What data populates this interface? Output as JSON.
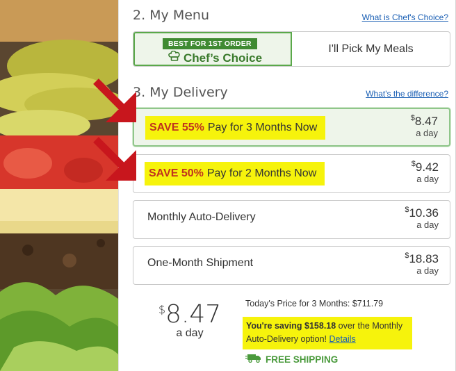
{
  "menu": {
    "section_title": "2. My Menu",
    "help_link": "What is Chef's Choice?",
    "chef_badge": "BEST FOR 1ST ORDER",
    "chef_label": "Chef’s Choice",
    "pick_label": "I'll Pick My Meals"
  },
  "delivery": {
    "section_title": "3. My Delivery",
    "help_link": "What's the difference?",
    "options": [
      {
        "save": "SAVE 55%",
        "label": "Pay for 3 Months Now",
        "currency": "$",
        "price": "8.47",
        "per": "a day",
        "selected": true
      },
      {
        "save": "SAVE 50%",
        "label": "Pay for 2 Months Now",
        "currency": "$",
        "price": "9.42",
        "per": "a day",
        "selected": false
      },
      {
        "label": "Monthly Auto-Delivery",
        "currency": "$",
        "price": "10.36",
        "per": "a day",
        "selected": false
      },
      {
        "label": "One-Month Shipment",
        "currency": "$",
        "price": "18.83",
        "per": "a day",
        "selected": false
      }
    ]
  },
  "summary": {
    "currency": "$",
    "price": "8.47",
    "per": "a day",
    "today_price": "Today's Price for 3 Months: $711.79",
    "saving_bold": "You're saving $158.18",
    "saving_rest": " over the Monthly Auto-Delivery option! ",
    "details_link": "Details",
    "free_shipping": "FREE SHIPPING"
  },
  "colors": {
    "accent_green": "#4a9a3c",
    "highlight_yellow": "#f6f30c",
    "save_red": "#c0321e",
    "link_blue": "#1a5fb4",
    "arrow_red": "#c8161d"
  },
  "icons": [
    "chef-hat-icon",
    "truck-icon",
    "red-arrow-icon"
  ]
}
